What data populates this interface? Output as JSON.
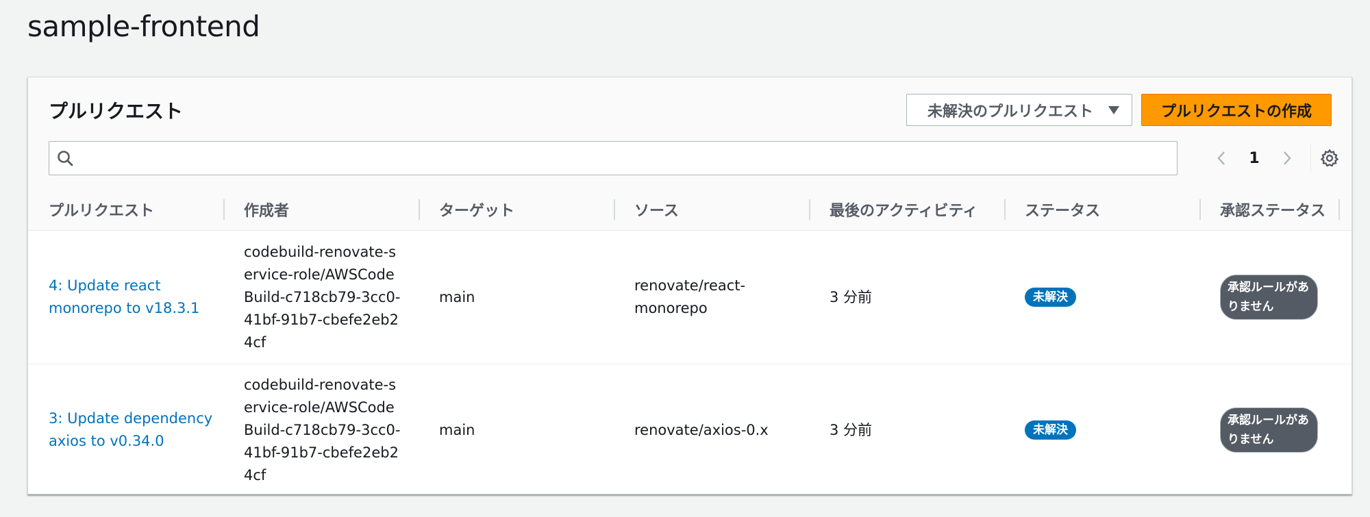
{
  "page": {
    "title": "sample-frontend"
  },
  "panel": {
    "title": "プルリクエスト",
    "filter": {
      "selected": "未解決のプルリクエスト",
      "icon": "caret-down-icon"
    },
    "create_button": "プルリクエストの作成",
    "search": {
      "value": "",
      "placeholder": "",
      "icon": "search-icon"
    },
    "pagination": {
      "current_page": "1"
    },
    "settings_icon": "gear-icon"
  },
  "table": {
    "columns": [
      "プルリクエスト",
      "作成者",
      "ターゲット",
      "ソース",
      "最後のアクティビティ",
      "ステータス",
      "承認ステータス"
    ],
    "rows": [
      {
        "title": "4: Update react monorepo to v18.3.1",
        "author": "codebuild-renovate-service-role/AWSCodeBuild-c718cb79-3cc0-41bf-91b7-cbefe2eb24cf",
        "target": "main",
        "source": "renovate/react-monorepo",
        "activity": "3 分前",
        "status": "未解決",
        "approval": "承認ルールがありません"
      },
      {
        "title": "3: Update dependency axios to v0.34.0",
        "author": "codebuild-renovate-service-role/AWSCodeBuild-c718cb79-3cc0-41bf-91b7-cbefe2eb24cf",
        "target": "main",
        "source": "renovate/axios-0.x",
        "activity": "3 分前",
        "status": "未解決",
        "approval": "承認ルールがありません"
      }
    ]
  },
  "colors": {
    "accent": "#ff9900",
    "link": "#0073bb",
    "badge_open": "#0073bb",
    "badge_approval": "#545b64"
  }
}
